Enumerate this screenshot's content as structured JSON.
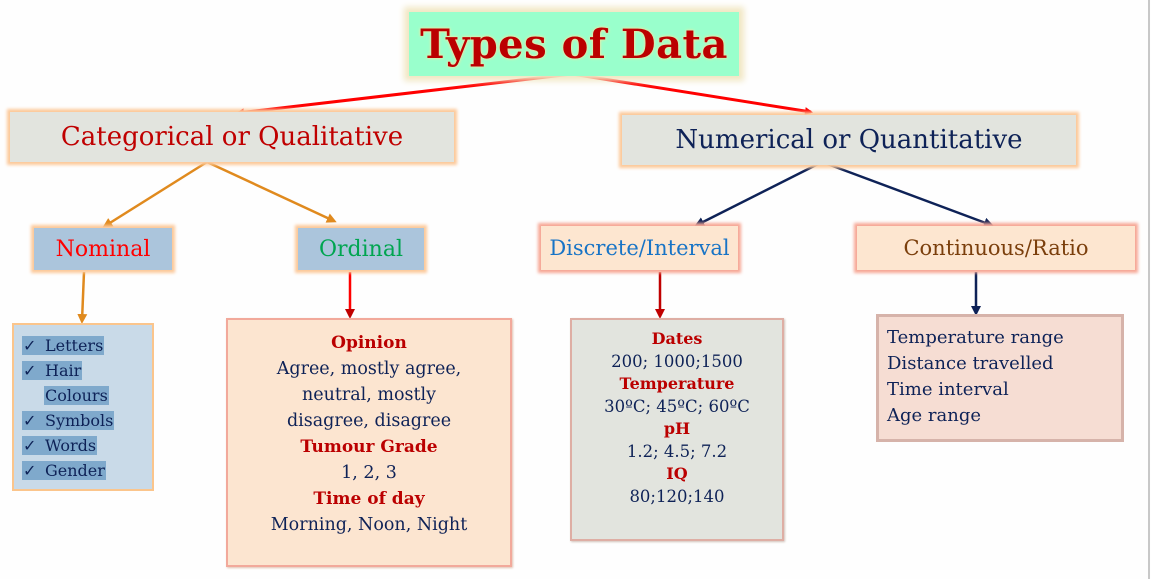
{
  "title": "Types of Data",
  "categories": {
    "categorical": {
      "label": "Categorical or Qualitative",
      "subtypes": {
        "nominal": {
          "label": "Nominal",
          "examples": [
            "Letters",
            "Hair",
            "Colours",
            "Symbols",
            "Words",
            "Gender"
          ],
          "check_mark": "✓"
        },
        "ordinal": {
          "label": "Ordinal",
          "groups": [
            {
              "heading": "Opinion",
              "lines": [
                "Agree, mostly agree,",
                "neutral, mostly",
                "disagree, disagree"
              ]
            },
            {
              "heading": "Tumour Grade",
              "lines": [
                "1, 2, 3"
              ]
            },
            {
              "heading": "Time of day",
              "lines": [
                "Morning, Noon, Night"
              ]
            }
          ]
        }
      }
    },
    "numerical": {
      "label": "Numerical or Quantitative",
      "subtypes": {
        "discrete": {
          "label": "Discrete/Interval",
          "groups": [
            {
              "heading": "Dates",
              "lines": [
                "200; 1000;1500"
              ]
            },
            {
              "heading": "Temperature",
              "lines": [
                "30ºC; 45ºC; 60ºC"
              ]
            },
            {
              "heading": "pH",
              "lines": [
                "1.2; 4.5; 7.2"
              ]
            },
            {
              "heading": "IQ",
              "lines": [
                "80;120;140"
              ]
            }
          ]
        },
        "continuous": {
          "label": "Continuous/Ratio",
          "examples": [
            "Temperature range",
            "Distance travelled",
            "Time interval",
            "Age range"
          ]
        }
      }
    }
  },
  "colors": {
    "title_bg": "#99ffcc",
    "title_text": "#bb0000",
    "arrow_top": "#ff0000",
    "arrow_categorical": "#e08a1e",
    "arrow_numerical": "#0e2257",
    "arrow_ordinal": "#ff0000",
    "arrow_discrete": "#c00000"
  }
}
